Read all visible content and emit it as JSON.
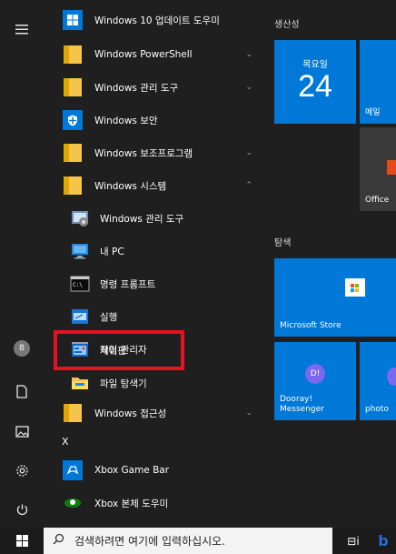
{
  "rail": {
    "menu_icon": "hamburger-icon",
    "user_initial": "8",
    "icons": [
      "hamburger-icon",
      "avatar-icon",
      "document-icon",
      "pictures-icon",
      "settings-icon",
      "power-icon"
    ]
  },
  "apps": [
    {
      "label": "Windows 10 업데이트 도우미",
      "icon": "windows-logo-icon",
      "chevron": ""
    },
    {
      "label": "Windows PowerShell",
      "icon": "folder-icon",
      "chevron": "⌄"
    },
    {
      "label": "Windows 관리 도구",
      "icon": "folder-icon",
      "chevron": "⌄"
    },
    {
      "label": "Windows 보안",
      "icon": "shield-icon",
      "chevron": ""
    },
    {
      "label": "Windows 보조프로그램",
      "icon": "folder-icon",
      "chevron": "⌄"
    },
    {
      "label": "Windows 시스템",
      "icon": "folder-icon",
      "chevron": "⌃"
    },
    {
      "label": "Windows 관리 도구",
      "icon": "admin-tools-icon",
      "chevron": ""
    },
    {
      "label": "내 PC",
      "icon": "this-pc-icon",
      "chevron": ""
    },
    {
      "label": "명령 프롬프트",
      "icon": "command-prompt-icon",
      "chevron": ""
    },
    {
      "label": "실행",
      "icon": "run-icon",
      "chevron": ""
    },
    {
      "label": "작업 관리자",
      "icon": "task-manager-icon",
      "chevron": ""
    },
    {
      "label": "제어판",
      "icon": "control-panel-icon",
      "chevron": ""
    },
    {
      "label": "파일 탐색기",
      "icon": "file-explorer-icon",
      "chevron": ""
    },
    {
      "label": "Windows 접근성",
      "icon": "folder-icon",
      "chevron": "⌄"
    },
    {
      "label": "Xbox Game Bar",
      "icon": "xbox-game-bar-icon",
      "chevron": ""
    },
    {
      "label": "Xbox 본체 도우미",
      "icon": "xbox-companion-icon",
      "chevron": ""
    }
  ],
  "letter_x": "X",
  "tiles": {
    "group1": "생산성",
    "calendar_day": "목요일",
    "calendar_date": "24",
    "mail": "메일",
    "office": "Office",
    "group2": "탐색",
    "store": "Microsoft Store",
    "dooray_line1": "Dooray!",
    "dooray_line2": "Messenger",
    "dooray_badge": "D!",
    "photo": "photo"
  },
  "taskbar": {
    "search_placeholder": "검색하려면 여기에 입력하십시오.",
    "task_view": "⊟i",
    "pinned": "b"
  },
  "colors": {
    "accent": "#0078d7",
    "highlight": "#e81123",
    "background": "#1f1f1f"
  }
}
